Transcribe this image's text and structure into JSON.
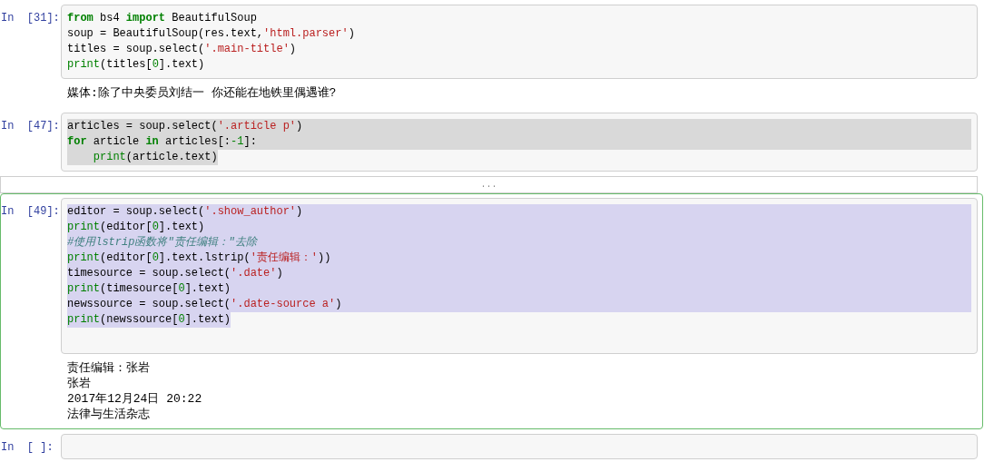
{
  "cells": [
    {
      "prompt": "In  [31]:",
      "selected": false,
      "lines": [
        {
          "highlighted": false,
          "tokens": [
            {
              "kind": "keyword",
              "text": "from"
            },
            {
              "kind": "plain",
              "text": " bs4 "
            },
            {
              "kind": "keyword",
              "text": "import"
            },
            {
              "kind": "plain",
              "text": " BeautifulSoup"
            }
          ]
        },
        {
          "highlighted": false,
          "tokens": [
            {
              "kind": "plain",
              "text": "soup = BeautifulSoup(res.text,"
            },
            {
              "kind": "string",
              "text": "'html.parser'"
            },
            {
              "kind": "plain",
              "text": ")"
            }
          ]
        },
        {
          "highlighted": false,
          "tokens": [
            {
              "kind": "plain",
              "text": "titles = soup.select("
            },
            {
              "kind": "string",
              "text": "'.main-title'"
            },
            {
              "kind": "plain",
              "text": ")"
            }
          ]
        },
        {
          "highlighted": false,
          "tokens": [
            {
              "kind": "builtin",
              "text": "print"
            },
            {
              "kind": "plain",
              "text": "(titles["
            },
            {
              "kind": "number",
              "text": "0"
            },
            {
              "kind": "plain",
              "text": "].text)"
            }
          ]
        }
      ],
      "output_lines": [
        "媒体:除了中央委员刘结一 你还能在地铁里偶遇谁?"
      ]
    },
    {
      "prompt": "In  [47]:",
      "selected": false,
      "lines": [
        {
          "highlighted": true,
          "tokens": [
            {
              "kind": "plain",
              "text": "articles = soup.select("
            },
            {
              "kind": "string",
              "text": "'.article p'"
            },
            {
              "kind": "plain",
              "text": ")"
            }
          ]
        },
        {
          "highlighted": true,
          "tokens": [
            {
              "kind": "keyword",
              "text": "for"
            },
            {
              "kind": "plain",
              "text": " article "
            },
            {
              "kind": "keyword",
              "text": "in"
            },
            {
              "kind": "plain",
              "text": " articles[:"
            },
            {
              "kind": "number",
              "text": "-1"
            },
            {
              "kind": "plain",
              "text": "]:"
            }
          ]
        },
        {
          "highlighted": true,
          "tokens": [
            {
              "kind": "builtin",
              "text": "    print"
            },
            {
              "kind": "plain",
              "text": "(article.text)"
            }
          ]
        }
      ],
      "collapsed_output": "..."
    },
    {
      "prompt": "In  [49]:",
      "selected": true,
      "trailing_blank_line": true,
      "lines": [
        {
          "highlighted": true,
          "tokens": [
            {
              "kind": "plain",
              "text": "editor = soup.select("
            },
            {
              "kind": "string",
              "text": "'.show_author'"
            },
            {
              "kind": "plain",
              "text": ")"
            }
          ]
        },
        {
          "highlighted": true,
          "tokens": [
            {
              "kind": "builtin",
              "text": "print"
            },
            {
              "kind": "plain",
              "text": "(editor["
            },
            {
              "kind": "number",
              "text": "0"
            },
            {
              "kind": "plain",
              "text": "].text)"
            }
          ]
        },
        {
          "highlighted": true,
          "tokens": [
            {
              "kind": "comment",
              "text": "#使用lstrip函数将\"责任编辑：\"去除"
            }
          ]
        },
        {
          "highlighted": true,
          "tokens": [
            {
              "kind": "builtin",
              "text": "print"
            },
            {
              "kind": "plain",
              "text": "(editor["
            },
            {
              "kind": "number",
              "text": "0"
            },
            {
              "kind": "plain",
              "text": "].text.lstrip("
            },
            {
              "kind": "string",
              "text": "'责任编辑：'"
            },
            {
              "kind": "plain",
              "text": "))"
            }
          ]
        },
        {
          "highlighted": true,
          "tokens": [
            {
              "kind": "plain",
              "text": "timesource = soup.select("
            },
            {
              "kind": "string",
              "text": "'.date'"
            },
            {
              "kind": "plain",
              "text": ")"
            }
          ]
        },
        {
          "highlighted": true,
          "tokens": [
            {
              "kind": "builtin",
              "text": "print"
            },
            {
              "kind": "plain",
              "text": "(timesource["
            },
            {
              "kind": "number",
              "text": "0"
            },
            {
              "kind": "plain",
              "text": "].text)"
            }
          ]
        },
        {
          "highlighted": true,
          "tokens": [
            {
              "kind": "plain",
              "text": "newssource = soup.select("
            },
            {
              "kind": "string",
              "text": "'.date-source a'"
            },
            {
              "kind": "plain",
              "text": ")"
            }
          ]
        },
        {
          "highlighted": true,
          "tokens": [
            {
              "kind": "builtin",
              "text": "print"
            },
            {
              "kind": "plain",
              "text": "(newssource["
            },
            {
              "kind": "number",
              "text": "0"
            },
            {
              "kind": "plain",
              "text": "].text)"
            }
          ]
        }
      ],
      "output_lines": [
        "责任编辑：张岩",
        "张岩",
        "2017年12月24日 20:22",
        "法律与生活杂志"
      ]
    },
    {
      "prompt": "In  [ ]:",
      "selected": false
    }
  ]
}
